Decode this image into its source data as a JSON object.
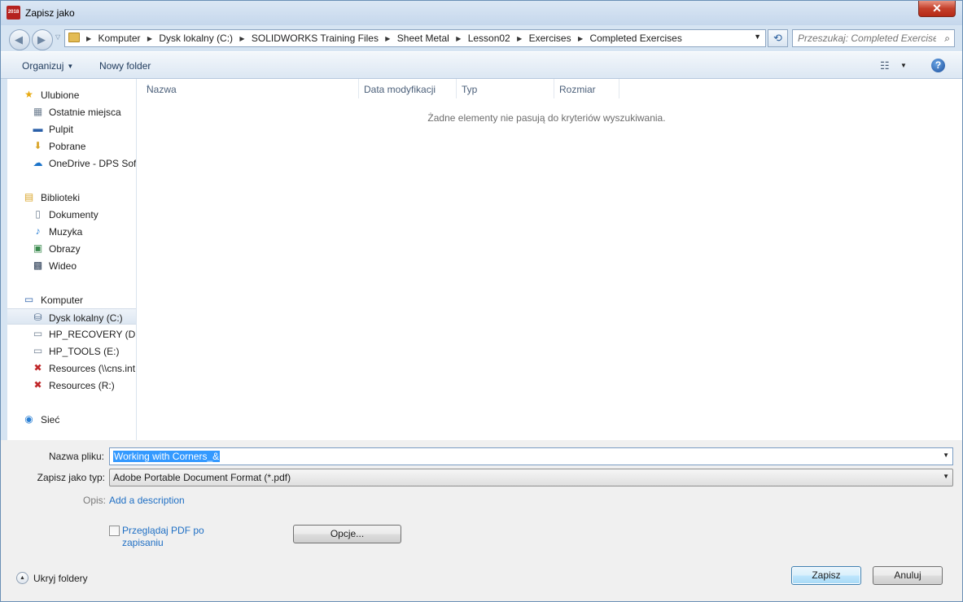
{
  "window": {
    "title": "Zapisz jako",
    "app_badge": "2018",
    "close_symbol": "✕"
  },
  "address": {
    "breadcrumbs": [
      "Komputer",
      "Dysk lokalny (C:)",
      "SOLIDWORKS Training Files",
      "Sheet Metal",
      "Lesson02",
      "Exercises",
      "Completed Exercises"
    ],
    "separator": "▶",
    "dropdown_symbol": "▼",
    "refresh_symbol": "⟲"
  },
  "search": {
    "placeholder": "Przeszukaj: Completed Exercises",
    "icon": "search-icon"
  },
  "toolbar": {
    "organize_label": "Organizuj",
    "new_folder_label": "Nowy folder",
    "caret": "▼",
    "view_symbol": "☷",
    "help_symbol": "?"
  },
  "nav_pane": {
    "favorites_label": "Ulubione",
    "favorites": [
      "Ostatnie miejsca",
      "Pulpit",
      "Pobrane",
      "OneDrive - DPS Soft"
    ],
    "libraries_label": "Biblioteki",
    "libraries": [
      "Dokumenty",
      "Muzyka",
      "Obrazy",
      "Wideo"
    ],
    "computer_label": "Komputer",
    "drives": [
      "Dysk lokalny (C:)",
      "HP_RECOVERY (D:)",
      "HP_TOOLS (E:)",
      "Resources (\\\\cns.int",
      "Resources (R:)"
    ],
    "selected_drive": "Dysk lokalny (C:)",
    "network_label": "Sieć"
  },
  "file_list": {
    "columns": [
      "Nazwa",
      "Data modyfikacji",
      "Typ",
      "Rozmiar"
    ],
    "sort_symbol": "^",
    "empty_message": "Żadne elementy nie pasują do kryteriów wyszukiwania."
  },
  "form": {
    "filename_label": "Nazwa pliku:",
    "filename_value": "Working with Corners_&",
    "filetype_label": "Zapisz jako typ:",
    "filetype_value": "Adobe Portable Document Format (*.pdf)",
    "description_label": "Opis:",
    "description_link": "Add a description",
    "view_pdf_label": "Przeglądaj PDF po zapisaniu",
    "view_pdf_checked": false,
    "options_button": "Opcje...",
    "hide_folders_label": "Ukryj foldery",
    "hide_folders_symbol": "▲",
    "save_button": "Zapisz",
    "cancel_button": "Anuluj"
  },
  "colors": {
    "link": "#1f6fc4",
    "selection": "#3399ff",
    "close_button": "#c4402b"
  }
}
